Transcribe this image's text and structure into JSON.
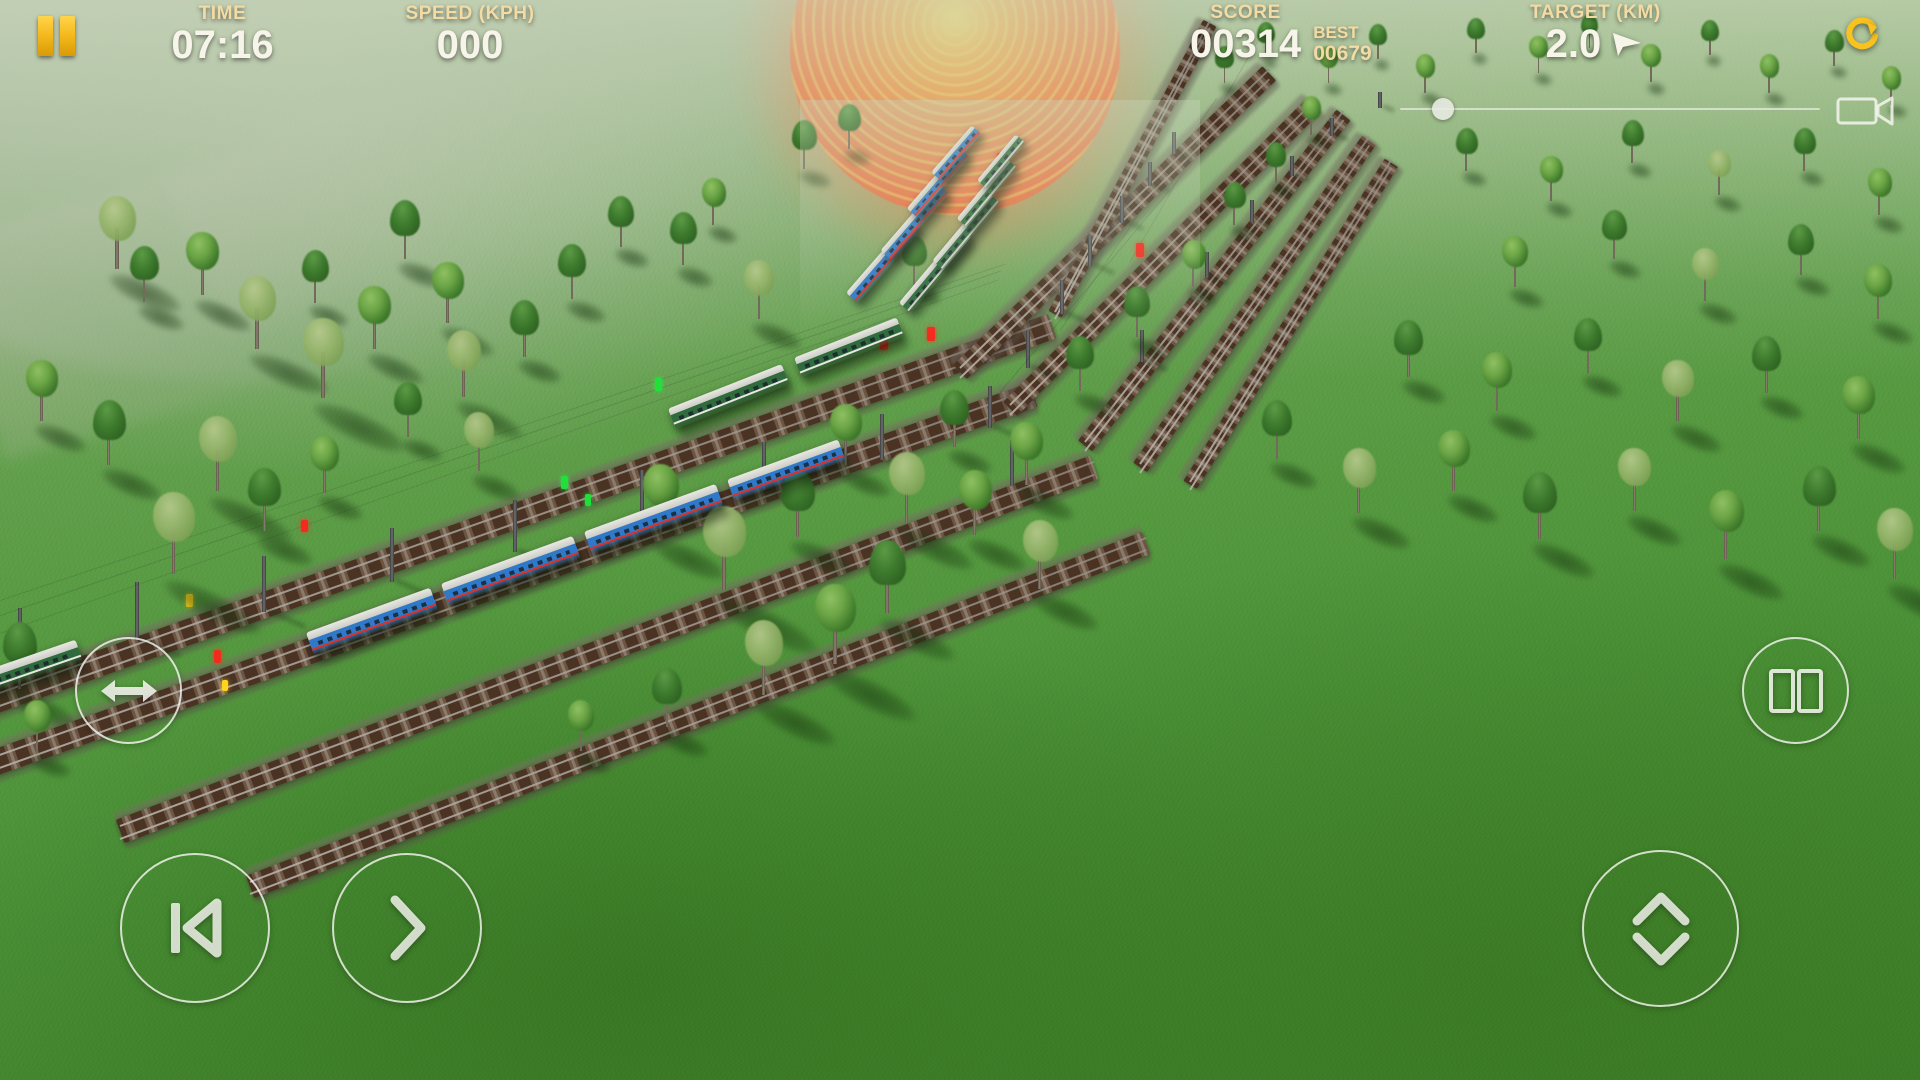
{
  "hud": {
    "pause": {
      "name": "pause-button",
      "label": "Pause"
    },
    "time": {
      "label": "TIME",
      "value": "07:16"
    },
    "speed": {
      "label": "SPEED (KPH)",
      "value": "000"
    },
    "score": {
      "label": "SCORE",
      "value": "00314",
      "best_label": "BEST",
      "best_value": "00679"
    },
    "target": {
      "label": "TARGET (KM)",
      "value": "2.0",
      "direction_icon": "direction-arrow-icon"
    },
    "restart": {
      "icon": "restart-icon",
      "label": "Restart"
    },
    "camera": {
      "icon": "video-camera-icon",
      "label": "Camera zoom",
      "value": 8,
      "min": 0,
      "max": 100
    }
  },
  "controls": {
    "switch_track": {
      "icon": "horizontal-double-arrow-icon",
      "label": "Switch track"
    },
    "reverse": {
      "icon": "skip-back-icon",
      "label": "Reverse"
    },
    "forward": {
      "icon": "chevron-right-icon",
      "label": "Forward"
    },
    "doors": {
      "icon": "doors-icon",
      "label": "Doors"
    },
    "vertical": {
      "icon": "chevron-up-down-icon",
      "label": "Raise / lower"
    }
  },
  "colors": {
    "hud_label": "#f3dba4",
    "hud_value": "#f7f4ea",
    "pause_yellow": "#f4b81c",
    "restart_yellow": "#f8c21f",
    "sun_core": "#ffd447",
    "sun_edge": "#ee3606",
    "grass_near": "#3c7d28",
    "grass_far": "#97ae8a",
    "button_stroke": "#f8f8f2"
  },
  "scene": {
    "name": "train-simulator-3d-view",
    "description": "Overhead view of green countryside with electrified railway tracks and passenger trains at sunset"
  }
}
